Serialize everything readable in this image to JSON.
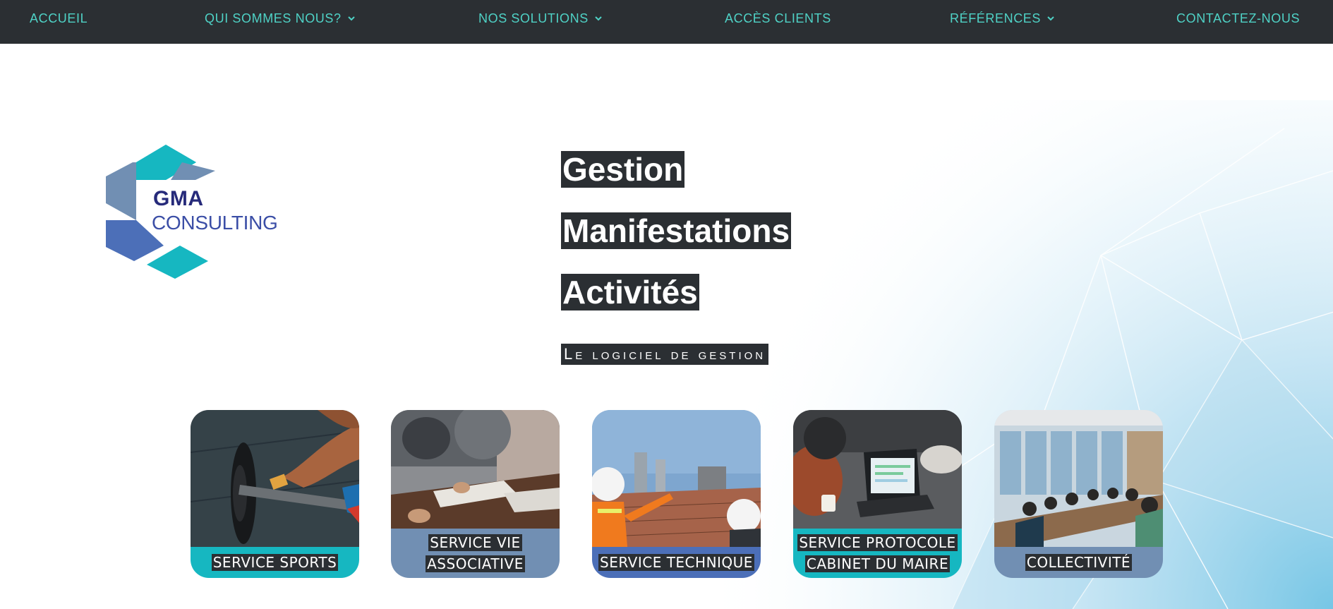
{
  "nav": {
    "items": [
      {
        "label": "ACCUEIL",
        "has_dropdown": false
      },
      {
        "label": "QUI SOMMES NOUS?",
        "has_dropdown": true
      },
      {
        "label": "NOS SOLUTIONS",
        "has_dropdown": true
      },
      {
        "label": "ACCÈS CLIENTS",
        "has_dropdown": false
      },
      {
        "label": "RÉFÉRENCES",
        "has_dropdown": true
      },
      {
        "label": "CONTACTEZ-NOUS",
        "has_dropdown": false
      }
    ]
  },
  "logo": {
    "line1": "GMA",
    "line2": "CONSULTING"
  },
  "hero": {
    "titles": [
      "Gestion",
      "Manifestations",
      "Activités"
    ],
    "subtitle": "Le logiciel de gestion"
  },
  "cards": [
    {
      "line1": "SERVICE SPORTS",
      "line2": ""
    },
    {
      "line1": "SERVICE VIE",
      "line2": "ASSOCIATIVE"
    },
    {
      "line1": "SERVICE TECHNIQUE",
      "line2": ""
    },
    {
      "line1": "SERVICE PROTOCOLE",
      "line2": "CABINET DU MAIRE"
    },
    {
      "line1": "COLLECTIVITÉ",
      "line2": ""
    }
  ],
  "colors": {
    "nav_bg": "#2b2f33",
    "nav_text": "#4fd2c6",
    "teal": "#16b7c1",
    "steel": "#718fb3",
    "blue": "#4c6fb8",
    "navy": "#262a7a"
  }
}
